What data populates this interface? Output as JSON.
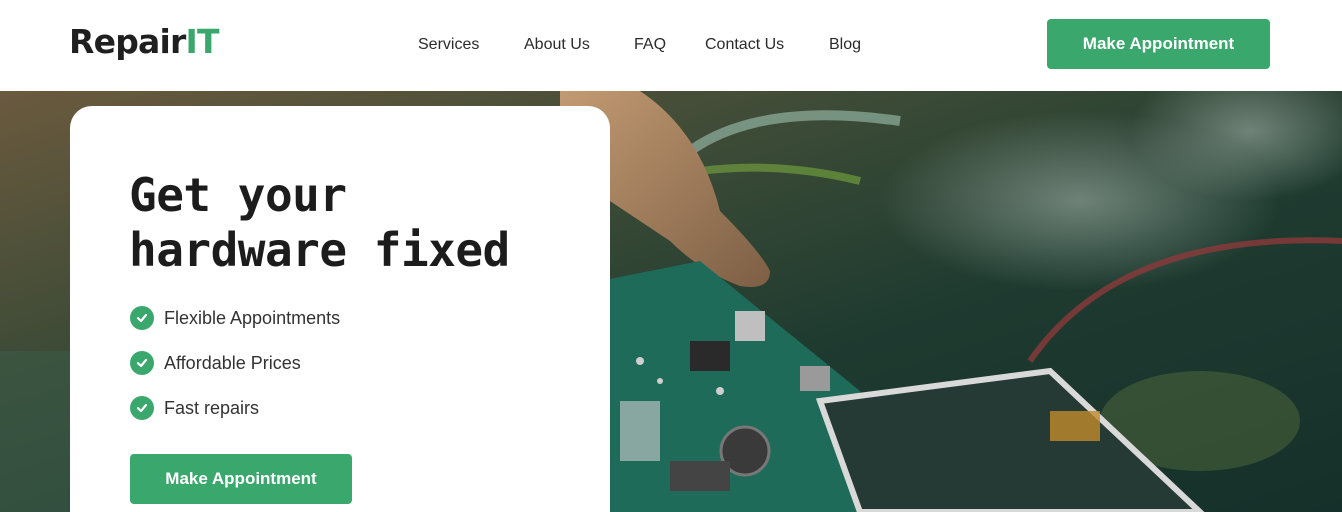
{
  "brand": {
    "name_main": "Repair",
    "name_accent": "IT",
    "accent_color": "#3aa76d"
  },
  "nav": {
    "items": [
      {
        "label": "Services"
      },
      {
        "label": "About Us"
      },
      {
        "label": "FAQ"
      },
      {
        "label": "Contact Us"
      },
      {
        "label": "Blog"
      }
    ]
  },
  "header": {
    "cta_label": "Make Appointment"
  },
  "hero": {
    "headline_line1": "Get your",
    "headline_line2": "hardware fixed",
    "features": [
      {
        "label": "Flexible Appointments",
        "icon": "check-circle-icon"
      },
      {
        "label": "Affordable Prices",
        "icon": "check-circle-icon"
      },
      {
        "label": "Fast repairs",
        "icon": "check-circle-icon"
      }
    ],
    "cta_label": "Make Appointment",
    "background_image": "hand-holding-circuit-board"
  }
}
